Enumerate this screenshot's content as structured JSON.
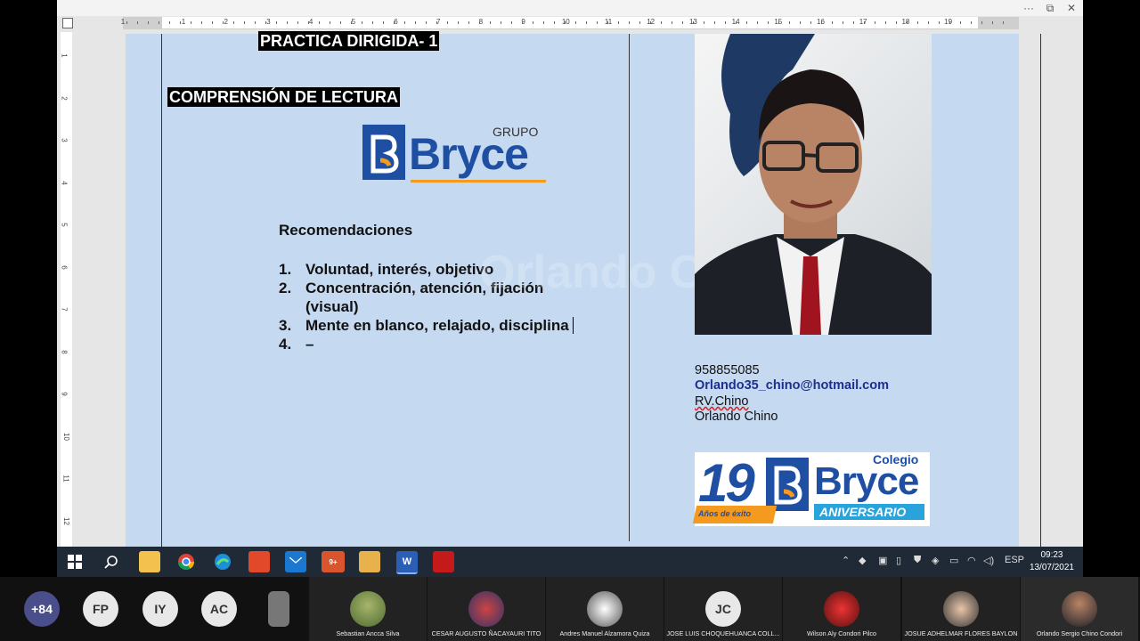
{
  "window_controls": {
    "more": "···",
    "restore": "⧉",
    "close": "✕"
  },
  "ruler": {
    "numbers": [
      "1",
      "1",
      "2",
      "3",
      "4",
      "5",
      "6",
      "7",
      "8",
      "9",
      "10",
      "11",
      "12",
      "13",
      "14",
      "15",
      "16",
      "17",
      "18",
      "19"
    ]
  },
  "vruler": {
    "numbers": [
      "1",
      "2",
      "3",
      "4",
      "5",
      "6",
      "7",
      "8",
      "9",
      "10",
      "11",
      "12"
    ]
  },
  "document": {
    "title": "PRACTICA DIRIGIDA- 1",
    "section_heading": "COMPRENSIÓN DE LECTURA",
    "logo": {
      "top": "GRUPO",
      "brand": "Bryce"
    },
    "recommendations_title": "Recomendaciones",
    "list": [
      {
        "num": "1.",
        "text": "Voluntad, interés, objetivo"
      },
      {
        "num": "2.",
        "text": "Concentración, atención, fijación"
      },
      {
        "num": "",
        "text": "(visual)"
      },
      {
        "num": "3.",
        "text": "Mente en blanco, relajado, disciplina"
      },
      {
        "num": "4.",
        "text": "–"
      }
    ],
    "watermark": "Orlando C",
    "contact": {
      "phone": "958855085",
      "email": "Orlando35_chino@hotmail.com",
      "handle": "RV.Chino",
      "name": "Orlando Chino"
    },
    "badge": {
      "number": "19",
      "colegio": "Colegio",
      "brand": "Bryce",
      "years": "Años de éxito",
      "aniversario": "ANIVERSARIO"
    }
  },
  "taskbar": {
    "icons": [
      "windows-icon",
      "search-icon",
      "file-explorer-icon",
      "chrome-icon",
      "edge-icon",
      "office-icon",
      "mail-icon",
      "teams-icon",
      "media-player-icon",
      "word-icon",
      "acrobat-icon"
    ],
    "teams_badge": "9+",
    "language": "ESP",
    "time": "09:23",
    "date": "13/07/2021"
  },
  "participants": {
    "overflow": "+84",
    "initials": [
      "FP",
      "IY",
      "AC"
    ],
    "tiles": [
      {
        "name": "Sebastian  Ancca Silva"
      },
      {
        "name": "CESAR AUGUSTO ÑACAYAURI TITO"
      },
      {
        "name": "Andres Manuel Alzamora Quiza"
      },
      {
        "name": "JOSE LUIS CHOQUEHUANCA COLL...",
        "initials": "JC"
      },
      {
        "name": "Wilson Aly Condori Pilco"
      },
      {
        "name": "JOSUE ADHELMAR FLORES  BAYLON"
      },
      {
        "name": "Orlando Sergio Chino Condori"
      }
    ]
  },
  "colors": {
    "page": "#c5d9f1",
    "brand_blue": "#1e4fa3",
    "brand_orange": "#f39a1f",
    "email": "#1f2f8f"
  }
}
